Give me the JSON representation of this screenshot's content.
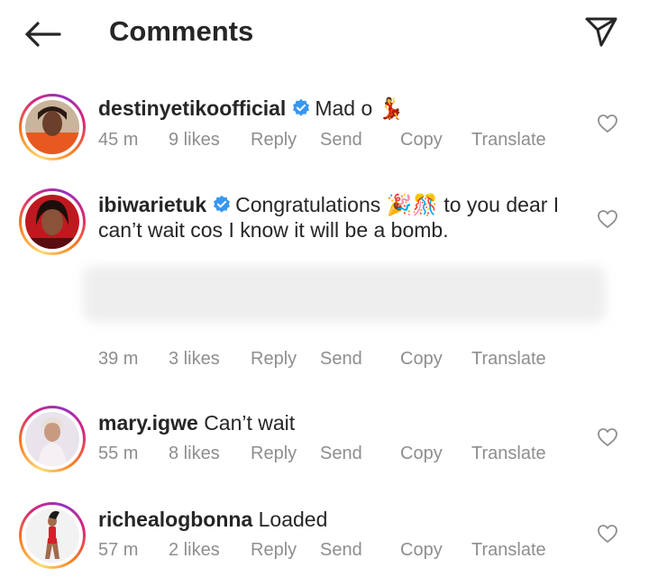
{
  "header": {
    "title": "Comments",
    "back_icon": "arrow-left-icon",
    "share_icon": "paper-plane-icon"
  },
  "accent_colors": {
    "verified": "#3897f0",
    "meta": "#8e8e8e",
    "text": "#262626"
  },
  "comments": [
    {
      "username": "destinyetikoofficial",
      "verified": true,
      "text": "Mad o 💃",
      "time": "45 m",
      "likes": "9 likes",
      "reply": "Reply",
      "send": "Send",
      "copy": "Copy",
      "translate": "Translate"
    },
    {
      "username": "ibiwarietuk",
      "verified": true,
      "text": "Congratulations 🎉🎊 to you dear I can’t wait cos I know it will be a bomb.",
      "time": "39 m",
      "likes": "3 likes",
      "reply": "Reply",
      "send": "Send",
      "copy": "Copy",
      "translate": "Translate"
    },
    {
      "username": "mary.igwe",
      "verified": false,
      "text": "Can’t wait",
      "time": "55 m",
      "likes": "8 likes",
      "reply": "Reply",
      "send": "Send",
      "copy": "Copy",
      "translate": "Translate"
    },
    {
      "username": "richealogbonna",
      "verified": false,
      "text": "Loaded",
      "time": "57 m",
      "likes": "2 likes",
      "reply": "Reply",
      "send": "Send",
      "copy": "Copy",
      "translate": "Translate"
    }
  ]
}
